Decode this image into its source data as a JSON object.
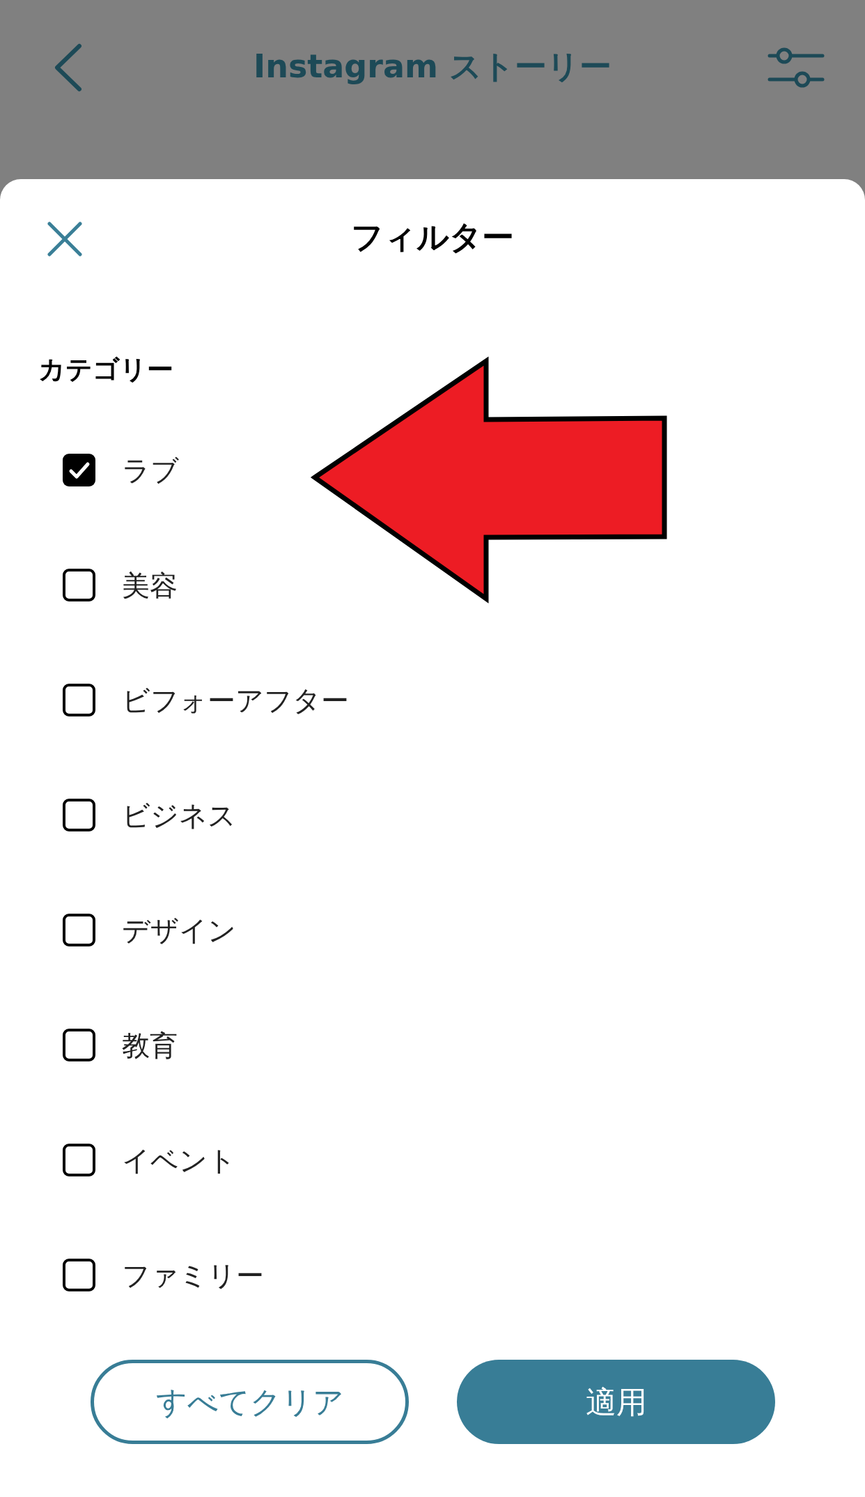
{
  "header": {
    "title": "Instagram ストーリー"
  },
  "sheet": {
    "title": "フィルター",
    "section": "カテゴリー",
    "categories": [
      {
        "label": "ラブ",
        "checked": true
      },
      {
        "label": "美容",
        "checked": false
      },
      {
        "label": "ビフォーアフター",
        "checked": false
      },
      {
        "label": "ビジネス",
        "checked": false
      },
      {
        "label": "デザイン",
        "checked": false
      },
      {
        "label": "教育",
        "checked": false
      },
      {
        "label": "イベント",
        "checked": false
      },
      {
        "label": "ファミリー",
        "checked": false
      }
    ],
    "buttons": [
      {
        "label": "すべてクリア",
        "kind": "outline"
      },
      {
        "label": "適用",
        "kind": "filled"
      }
    ]
  }
}
